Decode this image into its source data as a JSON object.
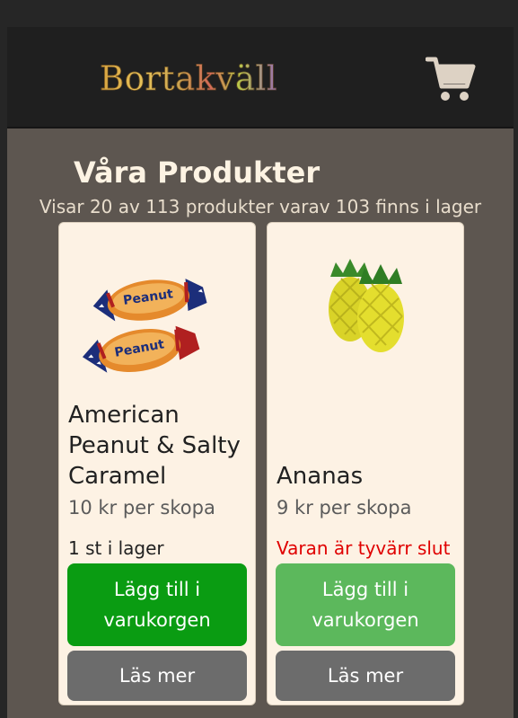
{
  "header": {
    "logo_text": "Bortakväll",
    "cart_icon": "shopping-cart-icon"
  },
  "main": {
    "title": "Våra Produkter",
    "subtitle": "Visar 20 av 113 produkter varav 103 finns i lager"
  },
  "products": [
    {
      "name": "American Peanut & Salty Caramel",
      "price": "10 kr per skopa",
      "stock": "1 st i lager",
      "add_label": "Lägg till i varukorgen",
      "more_label": "Läs mer",
      "image_icon": "wrapped-candy-image"
    },
    {
      "name": "Ananas",
      "price": "9 kr per skopa",
      "stock": "Varan är tyvärr slut",
      "add_label": "Lägg till i varukorgen",
      "more_label": "Läs mer",
      "image_icon": "pineapple-candy-image"
    }
  ],
  "colors": {
    "add_active": "#0a9c12",
    "add_disabled": "#5cb85c",
    "out_of_stock": "#e00000",
    "in_stock": "#212121"
  }
}
